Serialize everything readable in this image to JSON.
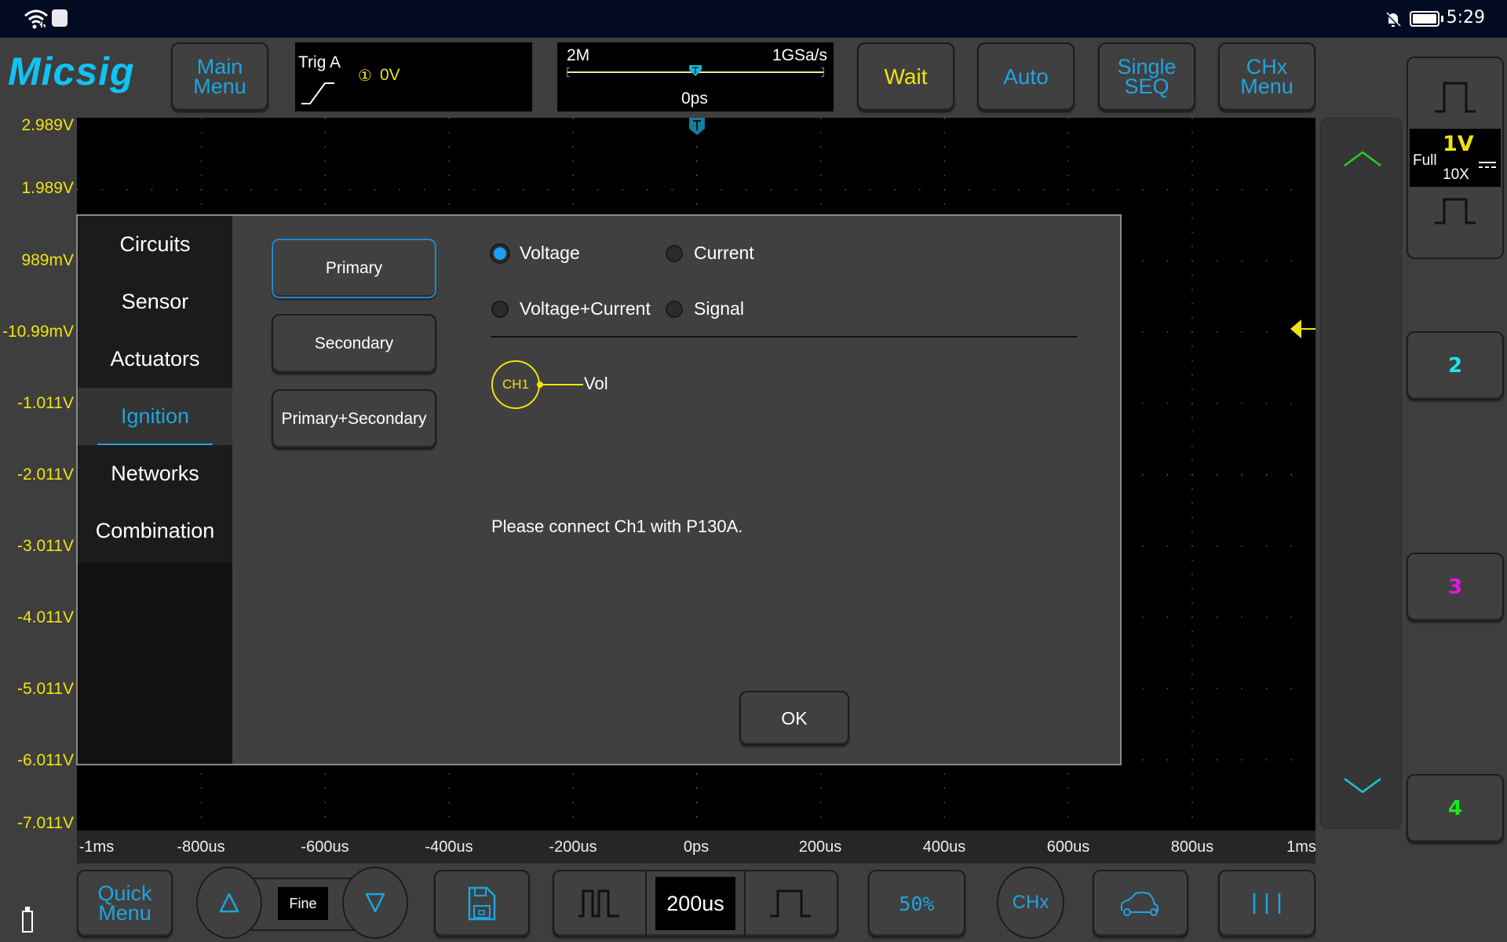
{
  "status_bar": {
    "time": "5:29",
    "left_icons": [
      "wifi-icon",
      "huawei-app-icon"
    ],
    "right_icons": [
      "notifications-muted-icon",
      "battery-icon"
    ]
  },
  "toolbar": {
    "logo": "Micsig",
    "main_menu": [
      "Main",
      "Menu"
    ],
    "trigger": {
      "label": "Trig A",
      "channel_badge": "①",
      "level": "0V",
      "edge": "rising"
    },
    "horizontal": {
      "memory_depth": "2M",
      "sample_rate": "1GSa/s",
      "position": "0ps"
    },
    "wait_label": "Wait",
    "auto_label": "Auto",
    "single_seq": [
      "Single",
      "SEQ"
    ],
    "chx_menu": [
      "CHx",
      "Menu"
    ]
  },
  "grid": {
    "voltage_labels": [
      "2.989V",
      "1.989V",
      "989mV",
      "-10.99mV",
      "-1.011V",
      "-2.011V",
      "-3.011V",
      "-4.011V",
      "-5.011V",
      "-6.011V",
      "-7.011V"
    ],
    "time_labels": [
      "-1ms",
      "-800us",
      "-600us",
      "-400us",
      "-200us",
      "0ps",
      "200us",
      "400us",
      "600us",
      "800us",
      "1ms"
    ],
    "trigger_marker": "T"
  },
  "channel_panel": {
    "ch1": {
      "scale": "1V",
      "bandwidth": "Full",
      "probe": "10X",
      "coupling": "DC"
    },
    "ch2_label": "2",
    "ch3_label": "3",
    "ch4_label": "4"
  },
  "colors": {
    "ch1": "#f0e40e",
    "ch2": "#1ee6f0",
    "ch3": "#e614e6",
    "ch4": "#1ee61e",
    "accent": "#1ea4e0"
  },
  "dialog": {
    "categories": [
      {
        "label": "Circuits",
        "active": false
      },
      {
        "label": "Sensor",
        "active": false
      },
      {
        "label": "Actuators",
        "active": false
      },
      {
        "label": "Ignition",
        "active": true
      },
      {
        "label": "Networks",
        "active": false
      },
      {
        "label": "Combination",
        "active": false
      }
    ],
    "subtypes": [
      {
        "label": "Primary",
        "selected": true
      },
      {
        "label": "Secondary",
        "selected": false
      },
      {
        "label": "Primary+Secondary",
        "selected": false
      }
    ],
    "measure_options": [
      {
        "label": "Voltage",
        "checked": true
      },
      {
        "label": "Current",
        "checked": false
      },
      {
        "label": "Voltage+Current",
        "checked": false
      },
      {
        "label": "Signal",
        "checked": false
      }
    ],
    "connection": {
      "channel": "CH1",
      "signal": "Vol"
    },
    "message": "Please connect Ch1 with P130A.",
    "ok_label": "OK"
  },
  "bottom_bar": {
    "quick_menu": [
      "Quick",
      "Menu"
    ],
    "step_mode": "Fine",
    "timebase": "200us",
    "trigger_50": "50%",
    "chx": "CHx"
  }
}
